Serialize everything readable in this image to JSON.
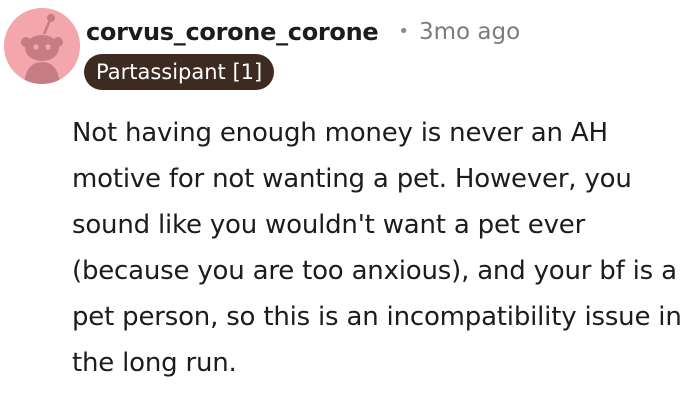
{
  "comment": {
    "author": {
      "username": "corvus_corone_corone",
      "avatar_icon": "snoo-avatar-icon",
      "avatar_bg": "#f3a7ad"
    },
    "separator": "•",
    "timestamp": "3mo ago",
    "flair": {
      "label": "Partassipant [1]",
      "bg_color": "#3d2a20",
      "text_color": "#ffffff"
    },
    "body": "Not having enough money is never an AH motive for not wanting a pet. However, you sound like you wouldn't want a pet ever (because you are too anxious), and your bf is a pet person, so this is an incompatibility issue in the long run."
  }
}
